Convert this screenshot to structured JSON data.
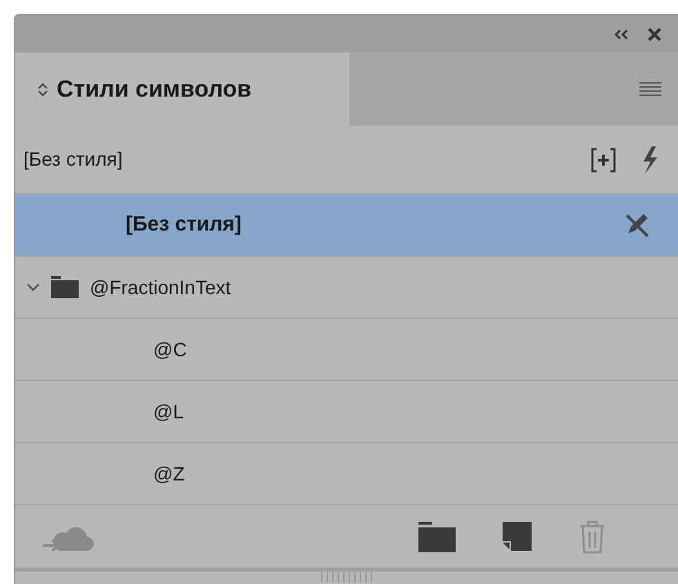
{
  "tab": {
    "label": "Стили символов",
    "selected": true
  },
  "current_style": "[Без стиля]",
  "styles": [
    {
      "kind": "style",
      "name": "[Без стиля]",
      "selected": true
    },
    {
      "kind": "group",
      "name": "@FractionInText",
      "selected": false,
      "expanded": true,
      "children": [
        {
          "kind": "style",
          "name": "@C",
          "selected": false
        },
        {
          "kind": "style",
          "name": "@L",
          "selected": false
        },
        {
          "kind": "style",
          "name": "@Z",
          "selected": false
        }
      ]
    }
  ]
}
